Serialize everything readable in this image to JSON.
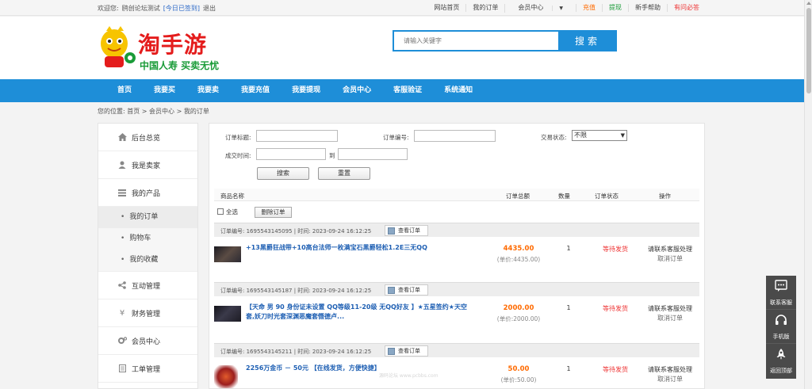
{
  "topbar": {
    "welcome": "欢迎您:",
    "username": "鸥创论坛测试",
    "signed": "[今日已签到]",
    "logout": "退出",
    "links": [
      {
        "label": "网站首页",
        "style": ""
      },
      {
        "label": "我的订单",
        "style": ""
      },
      {
        "label": "会员中心",
        "style": "dropdown"
      },
      {
        "label": "充值",
        "style": "orange"
      },
      {
        "label": "提现",
        "style": "green"
      },
      {
        "label": "新手帮助",
        "style": ""
      },
      {
        "label": "有问必答",
        "style": "red"
      }
    ]
  },
  "header": {
    "brand": "淘手游",
    "slogan": "中国人寿 买卖无忧",
    "search_placeholder": "请输入关键字",
    "search_button": "搜索"
  },
  "nav": {
    "items": [
      "首页",
      "我要买",
      "我要卖",
      "我要充值",
      "我要提现",
      "会员中心",
      "客服验证",
      "系统通知"
    ]
  },
  "breadcrumb": "您的位置: 首页 > 会员中心 > 我的订单",
  "sidebar": {
    "items": [
      {
        "label": "后台总览",
        "icon": "home-icon"
      },
      {
        "label": "我是卖家",
        "icon": "user-icon"
      },
      {
        "label": "我的产品",
        "icon": "list-icon"
      }
    ],
    "sub_items": [
      {
        "label": "我的订单",
        "active": true
      },
      {
        "label": "购物车",
        "active": false
      },
      {
        "label": "我的收藏",
        "active": false
      }
    ],
    "items_after": [
      {
        "label": "互动管理",
        "icon": "share-icon"
      },
      {
        "label": "财务管理",
        "icon": "yen-icon"
      },
      {
        "label": "会员中心",
        "icon": "gears-icon"
      },
      {
        "label": "工单管理",
        "icon": "file-icon"
      }
    ]
  },
  "filters": {
    "order_title_label": "订单标题:",
    "order_no_label": "订单编号:",
    "status_label": "交易状态:",
    "status_value": "不限",
    "time_label": "成交时间:",
    "to_label": "到",
    "search_button": "搜索",
    "reset_button": "重置"
  },
  "table": {
    "headers": {
      "name": "商品名称",
      "total": "订单总额",
      "qty": "数量",
      "status": "订单状态",
      "action": "操作"
    },
    "select_all": "全选",
    "delete_button": "删除订单"
  },
  "orders": [
    {
      "no": "订单编号: 1695543145095 | 时间: 2023-09-24 16:12:25",
      "view": "查看订单",
      "title": "+13黑爵狂战带+10高台法师一枚满宝石黑爵轻松1.2E三无QQ",
      "price": "4435.00",
      "unit": "(单价:4435.00)",
      "qty": "1",
      "status": "等待发货",
      "action1": "请联系客服处理",
      "action2": "取消订单"
    },
    {
      "no": "订单编号: 1695543145187 | 时间: 2023-09-24 16:12:25",
      "view": "查看订单",
      "title": "【天命 男 90 身份证未设置 QQ等级11-20级 无QQ好友 】★五星签约★天空套,妖刀时光套深渊恶魔套慑德卢...",
      "price": "2000.00",
      "unit": "(单价:2000.00)",
      "qty": "1",
      "status": "等待发货",
      "action1": "请联系客服处理",
      "action2": "取消订单"
    },
    {
      "no": "订单编号: 1695543145211 | 时间: 2023-09-24 16:12:25",
      "view": "查看订单",
      "title": "2256万金币 － 50元 【在线发货，方便快捷】",
      "price": "50.00",
      "unit": "(单价:50.00)",
      "qty": "1",
      "status": "等待发货",
      "action1": "请联系客服处理",
      "action2": "取消订单"
    }
  ],
  "float_bar": {
    "items": [
      {
        "label": "联系客服",
        "icon": "chat-icon"
      },
      {
        "label": "手机版",
        "icon": "headset-icon"
      },
      {
        "label": "返回顶部",
        "icon": "rocket-icon"
      }
    ]
  },
  "watermark": "源码论坛 www.pcbbs.com",
  "colors": {
    "brand_blue": "#1e8ed8",
    "price_orange": "#ff6a00",
    "status_red": "#ee3333",
    "link_blue": "#1e5fb3"
  }
}
